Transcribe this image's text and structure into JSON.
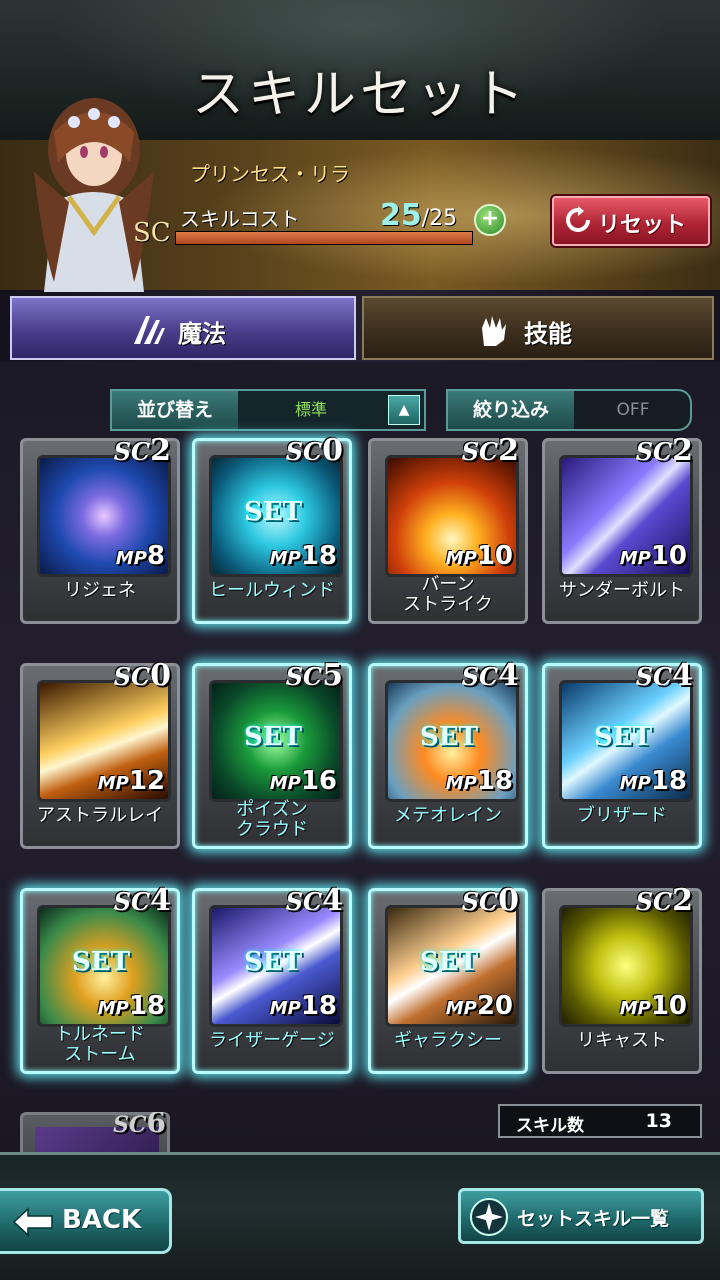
{
  "header": {
    "title": "スキルセット"
  },
  "character": {
    "name": "プリンセス・リラ",
    "cost_label": "スキルコスト",
    "sc_badge": "SC",
    "cost_current": "25",
    "cost_max": "/25",
    "cost_fill_fraction": 1.0,
    "reset_label": "リセット"
  },
  "tabs": [
    {
      "label": "魔法",
      "active": true
    },
    {
      "label": "技能",
      "active": false
    }
  ],
  "sort": {
    "label": "並び替え",
    "value": "標準"
  },
  "filter": {
    "label": "絞り込み",
    "value": "OFF"
  },
  "labels": {
    "sc_prefix": "SC",
    "mp_prefix": "MP",
    "set_label": "SET"
  },
  "skills": [
    {
      "name": "リジェネ",
      "sc": "2",
      "mp": "8",
      "set": false
    },
    {
      "name": "ヒールウィンド",
      "sc": "0",
      "mp": "18",
      "set": true
    },
    {
      "name": "バーン\nストライク",
      "sc": "2",
      "mp": "10",
      "set": false
    },
    {
      "name": "サンダーボルト",
      "sc": "2",
      "mp": "10",
      "set": false
    },
    {
      "name": "アストラルレイ",
      "sc": "0",
      "mp": "12",
      "set": false
    },
    {
      "name": "ポイズン\nクラウド",
      "sc": "5",
      "mp": "16",
      "set": true
    },
    {
      "name": "メテオレイン",
      "sc": "4",
      "mp": "18",
      "set": true
    },
    {
      "name": "ブリザード",
      "sc": "4",
      "mp": "18",
      "set": true
    },
    {
      "name": "トルネード\nストーム",
      "sc": "4",
      "mp": "18",
      "set": true
    },
    {
      "name": "ライザーゲージ",
      "sc": "4",
      "mp": "18",
      "set": true
    },
    {
      "name": "ギャラクシー",
      "sc": "0",
      "mp": "20",
      "set": true
    },
    {
      "name": "リキャスト",
      "sc": "2",
      "mp": "10",
      "set": false
    }
  ],
  "partial_skill": {
    "sc": "6"
  },
  "skill_count": {
    "label": "スキル数",
    "value": "13"
  },
  "footer": {
    "back_label": "BACK",
    "set_list_label": "セットスキル一覧"
  }
}
